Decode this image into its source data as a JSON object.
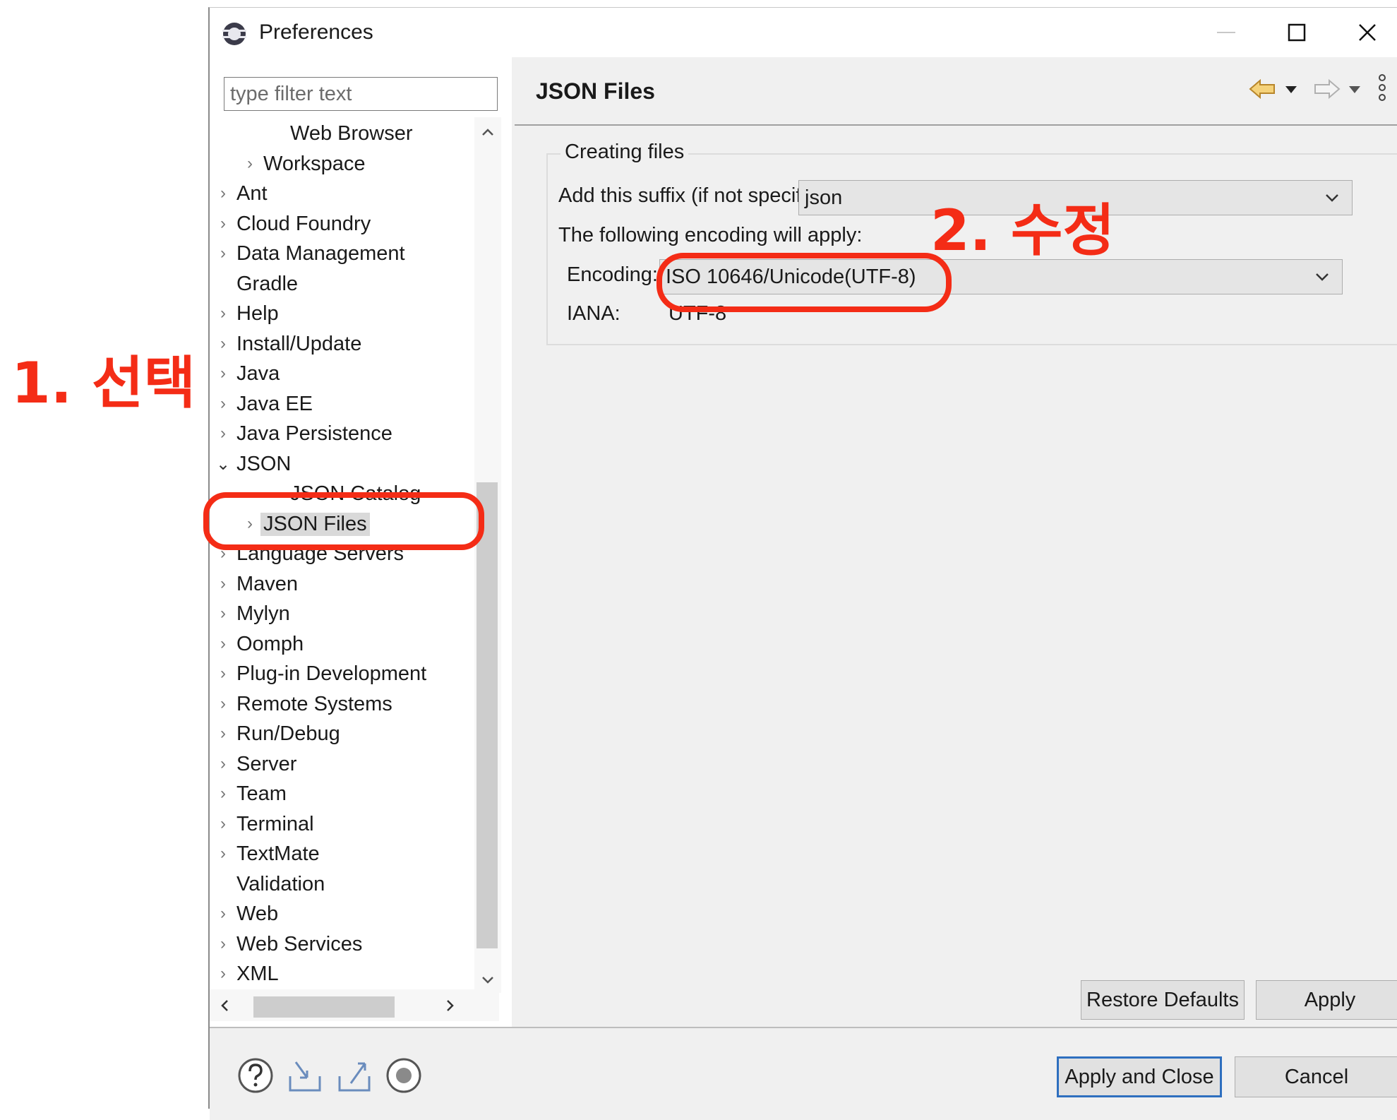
{
  "window": {
    "title": "Preferences"
  },
  "filter": {
    "placeholder": "type filter text"
  },
  "tree": {
    "items": [
      {
        "label": "Web Browser",
        "expander": "none"
      },
      {
        "label": "Workspace",
        "expander": "collapsed"
      },
      {
        "label": "Ant",
        "expander": "collapsed"
      },
      {
        "label": "Cloud Foundry",
        "expander": "collapsed"
      },
      {
        "label": "Data Management",
        "expander": "collapsed"
      },
      {
        "label": "Gradle",
        "expander": "none"
      },
      {
        "label": "Help",
        "expander": "collapsed"
      },
      {
        "label": "Install/Update",
        "expander": "collapsed"
      },
      {
        "label": "Java",
        "expander": "collapsed"
      },
      {
        "label": "Java EE",
        "expander": "collapsed"
      },
      {
        "label": "Java Persistence",
        "expander": "collapsed"
      },
      {
        "label": "JSON",
        "expander": "expanded"
      },
      {
        "label": "JSON Catalog",
        "expander": "none"
      },
      {
        "label": "JSON Files",
        "expander": "collapsed",
        "selected": true
      },
      {
        "label": "Language Servers",
        "expander": "collapsed"
      },
      {
        "label": "Maven",
        "expander": "collapsed"
      },
      {
        "label": "Mylyn",
        "expander": "collapsed"
      },
      {
        "label": "Oomph",
        "expander": "collapsed"
      },
      {
        "label": "Plug-in Development",
        "expander": "collapsed"
      },
      {
        "label": "Remote Systems",
        "expander": "collapsed"
      },
      {
        "label": "Run/Debug",
        "expander": "collapsed"
      },
      {
        "label": "Server",
        "expander": "collapsed"
      },
      {
        "label": "Team",
        "expander": "collapsed"
      },
      {
        "label": "Terminal",
        "expander": "collapsed"
      },
      {
        "label": "TextMate",
        "expander": "collapsed"
      },
      {
        "label": "Validation",
        "expander": "none"
      },
      {
        "label": "Web",
        "expander": "collapsed"
      },
      {
        "label": "Web Services",
        "expander": "collapsed"
      },
      {
        "label": "XML",
        "expander": "collapsed"
      }
    ]
  },
  "page": {
    "title": "JSON Files",
    "group_title": "Creating files",
    "suffix_label": "Add this suffix (if not specified):",
    "suffix_value": "json",
    "encoding_intro": "The following encoding will apply:",
    "encoding_label": "Encoding:",
    "encoding_value": "ISO 10646/Unicode(UTF-8)",
    "iana_label": "IANA:",
    "iana_value": "UTF-8",
    "restore_defaults": "Restore Defaults",
    "apply": "Apply"
  },
  "footer": {
    "apply_and_close": "Apply and Close",
    "cancel": "Cancel"
  },
  "annotations": {
    "step1": "1. 선택",
    "step2": "2. 수정"
  },
  "colors": {
    "annotation": "#f42c16",
    "default_button_border": "#2e6fbf"
  },
  "icons": [
    "preferences-icon",
    "minimize-icon",
    "maximize-icon",
    "close-icon",
    "back-arrow-icon",
    "forward-arrow-icon",
    "view-menu-icon",
    "help-icon",
    "import-icon",
    "export-icon",
    "record-icon"
  ]
}
